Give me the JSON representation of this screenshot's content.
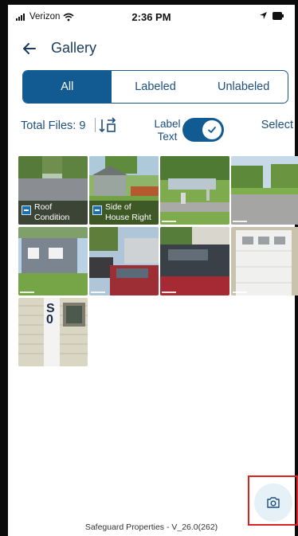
{
  "status_bar": {
    "carrier": "Verizon",
    "time": "2:36 PM"
  },
  "header": {
    "title": "Gallery"
  },
  "tabs": [
    {
      "label": "All",
      "active": true
    },
    {
      "label": "Labeled",
      "active": false
    },
    {
      "label": "Unlabeled",
      "active": false
    }
  ],
  "toolbar": {
    "total_files": "Total Files: 9",
    "label_text_line1": "Label",
    "label_text_line2": "Text",
    "label_toggle_on": true,
    "select_label": "Select"
  },
  "photos": [
    {
      "label_line1": "Roof",
      "label_line2": "Condition",
      "labeled": true
    },
    {
      "label_line1": "Side of",
      "label_line2": "House Right",
      "labeled": true
    },
    {
      "label_line1": "",
      "label_line2": "",
      "labeled": false
    },
    {
      "label_line1": "",
      "label_line2": "",
      "labeled": false
    },
    {
      "label_line1": "",
      "label_line2": "",
      "labeled": false
    },
    {
      "label_line1": "",
      "label_line2": "",
      "labeled": false
    },
    {
      "label_line1": "",
      "label_line2": "",
      "labeled": false
    },
    {
      "label_line1": "",
      "label_line2": "",
      "labeled": false
    },
    {
      "label_line1": "",
      "label_line2": "",
      "labeled": false
    }
  ],
  "footer": {
    "text": "Safeguard Properties - V_26.0(262)"
  },
  "colors": {
    "primary": "#125a92",
    "text": "#1d4f7c",
    "highlight": "#e02020"
  }
}
